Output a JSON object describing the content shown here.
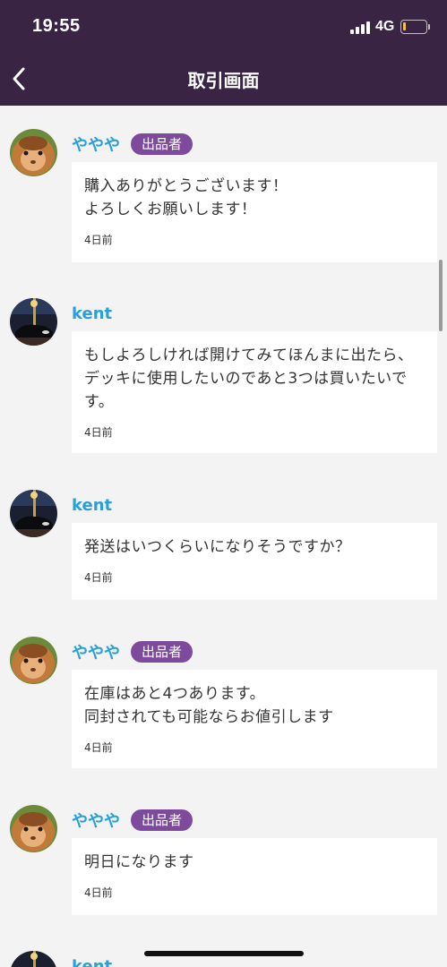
{
  "status_bar": {
    "time": "19:55",
    "network": "4G",
    "battery_color": "#f5c242"
  },
  "header": {
    "back_icon": "chevron-left-icon",
    "title": "取引画面",
    "background": "#3a2444"
  },
  "colors": {
    "sender_name": "#2aa0d8",
    "seller_badge": "#7d4a9c",
    "bubble_bg": "#ffffff",
    "page_bg": "#f3f3f3"
  },
  "messages": [
    {
      "sender": "ややや",
      "badge": "出品者",
      "avatar": "guinea-pig-avatar",
      "text": "購入ありがとうございます！\nよろしくお願いします！",
      "time": "4日前"
    },
    {
      "sender": "kent",
      "badge": "",
      "avatar": "night-car-avatar",
      "text": "もしよろしければ開けてみてほんまに出たら、デッキに使用したいのであと3つは買いたいです。",
      "time": "4日前"
    },
    {
      "sender": "kent",
      "badge": "",
      "avatar": "night-car-avatar",
      "text": "発送はいつくらいになりそうですか？",
      "time": "4日前"
    },
    {
      "sender": "ややや",
      "badge": "出品者",
      "avatar": "guinea-pig-avatar",
      "text": "在庫はあと4つあります。\n同封されても可能ならお値引します",
      "time": "4日前"
    },
    {
      "sender": "ややや",
      "badge": "出品者",
      "avatar": "guinea-pig-avatar",
      "text": "明日になります",
      "time": "4日前"
    },
    {
      "sender": "kent",
      "badge": "",
      "avatar": "night-car-avatar",
      "text": "",
      "time": ""
    }
  ]
}
